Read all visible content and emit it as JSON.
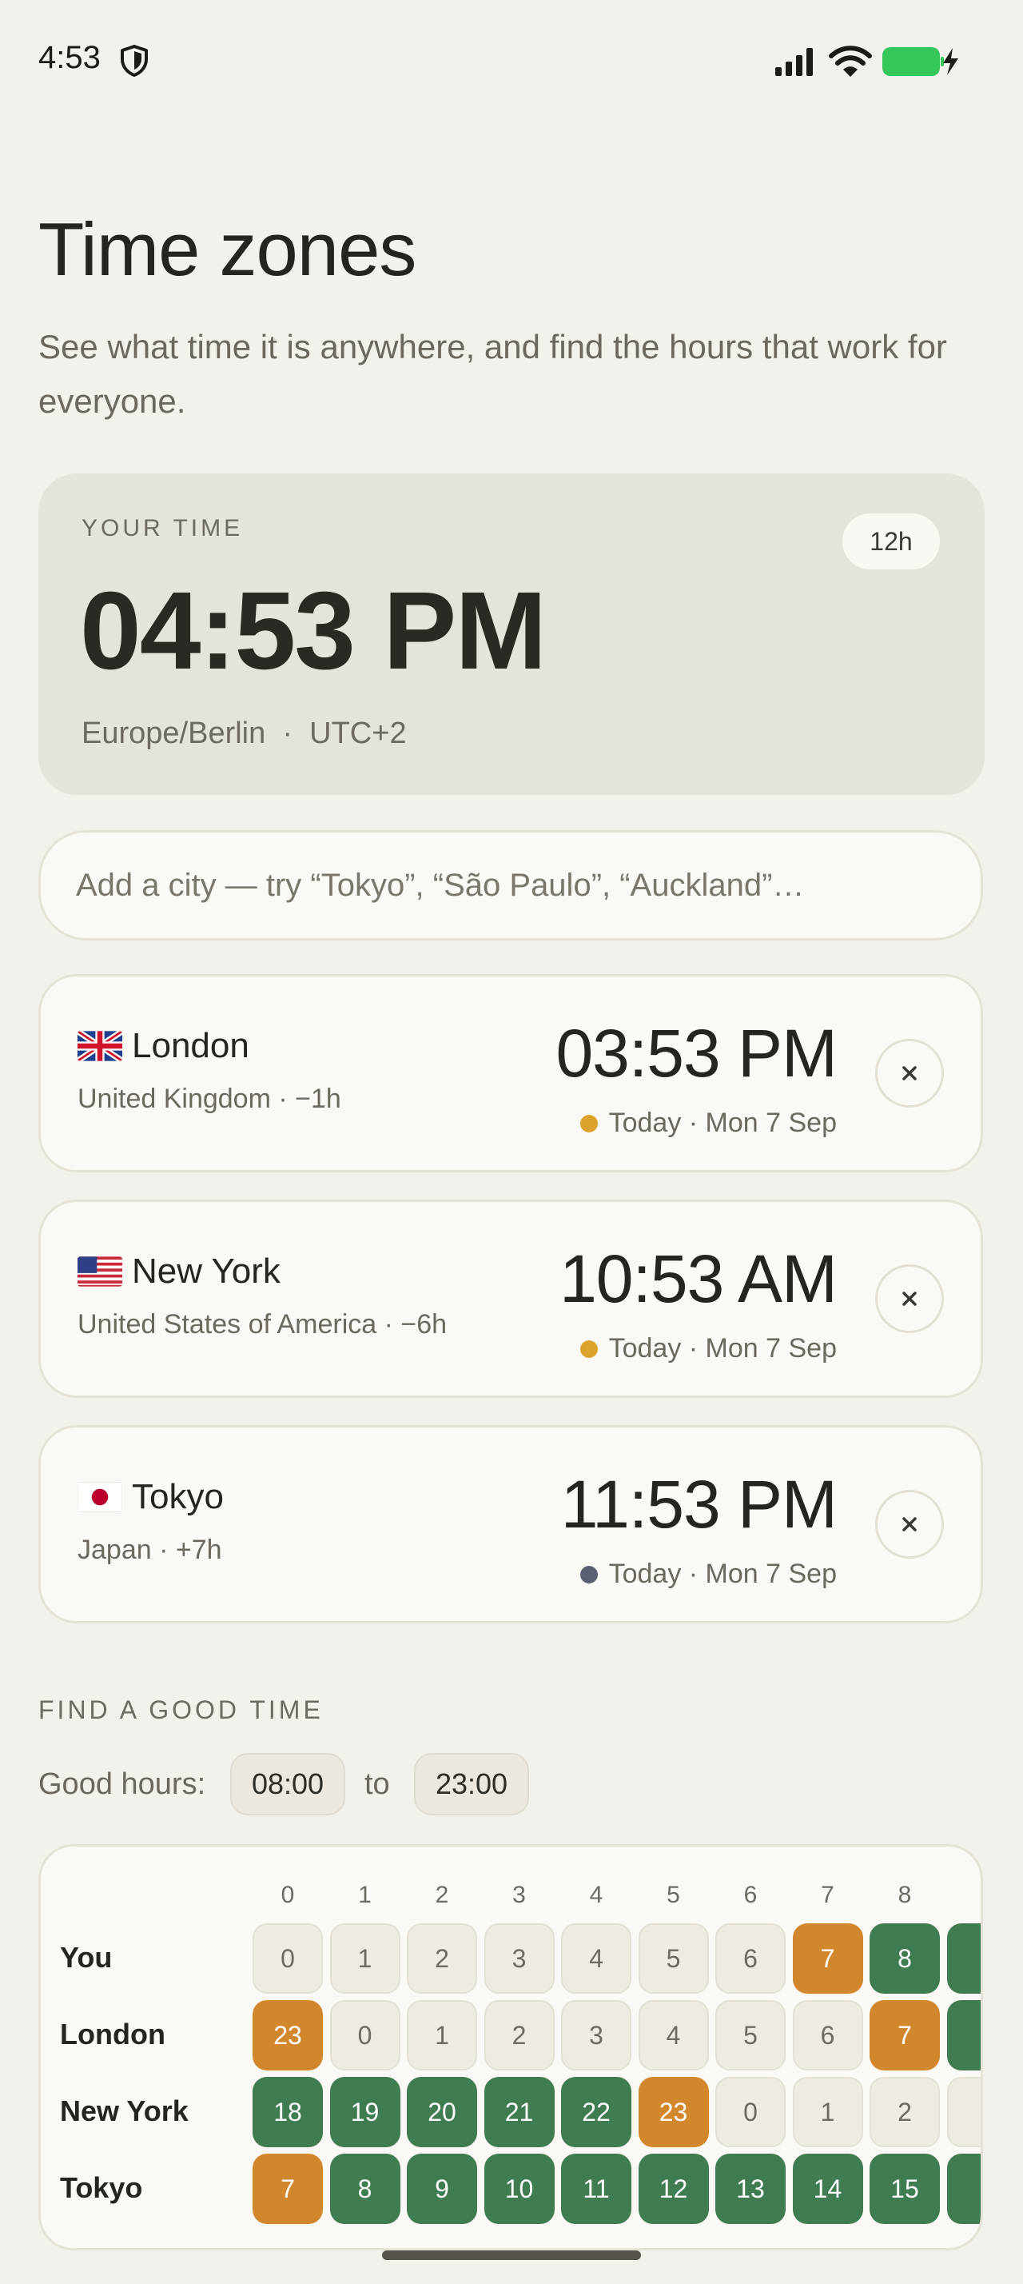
{
  "status_bar": {
    "time": "4:53"
  },
  "header": {
    "title": "Time zones",
    "subtitle": "See what time it is anywhere, and find the hours that work for everyone."
  },
  "your_time": {
    "label": "YOUR TIME",
    "format_toggle": "12h",
    "time": "04:53 PM",
    "zone": "Europe/Berlin",
    "separator": "·",
    "offset": "UTC+2"
  },
  "search": {
    "placeholder": "Add a city — try “Tokyo”, “São Paulo”, “Auckland”…"
  },
  "cities": [
    {
      "flag": "uk-flag",
      "name": "London",
      "meta": "United Kingdom · −1h",
      "time": "03:53 PM",
      "day": "Today · Mon 7 Sep",
      "dot_color": "#dca32c"
    },
    {
      "flag": "us-flag",
      "name": "New York",
      "meta": "United States of America · −6h",
      "time": "10:53 AM",
      "day": "Today · Mon 7 Sep",
      "dot_color": "#dca32c"
    },
    {
      "flag": "jp-flag",
      "name": "Tokyo",
      "meta": "Japan · +7h",
      "time": "11:53 PM",
      "day": "Today · Mon 7 Sep",
      "dot_color": "#5b6070"
    }
  ],
  "find_good_time": {
    "section_label": "FIND A GOOD TIME",
    "good_hours_label": "Good hours:",
    "from": "08:00",
    "to_label": "to",
    "to": "23:00"
  },
  "grid": {
    "hours_header": [
      "0",
      "1",
      "2",
      "3",
      "4",
      "5",
      "6",
      "7",
      "8"
    ],
    "rows": [
      {
        "label": "You",
        "cells": [
          {
            "v": "0",
            "s": "off"
          },
          {
            "v": "1",
            "s": "off"
          },
          {
            "v": "2",
            "s": "off"
          },
          {
            "v": "3",
            "s": "off"
          },
          {
            "v": "4",
            "s": "off"
          },
          {
            "v": "5",
            "s": "off"
          },
          {
            "v": "6",
            "s": "off"
          },
          {
            "v": "7",
            "s": "edge"
          },
          {
            "v": "8",
            "s": "good"
          },
          {
            "v": "",
            "s": "good"
          }
        ]
      },
      {
        "label": "London",
        "cells": [
          {
            "v": "23",
            "s": "edge"
          },
          {
            "v": "0",
            "s": "off"
          },
          {
            "v": "1",
            "s": "off"
          },
          {
            "v": "2",
            "s": "off"
          },
          {
            "v": "3",
            "s": "off"
          },
          {
            "v": "4",
            "s": "off"
          },
          {
            "v": "5",
            "s": "off"
          },
          {
            "v": "6",
            "s": "off"
          },
          {
            "v": "7",
            "s": "edge"
          },
          {
            "v": "",
            "s": "good"
          }
        ]
      },
      {
        "label": "New York",
        "cells": [
          {
            "v": "18",
            "s": "good"
          },
          {
            "v": "19",
            "s": "good"
          },
          {
            "v": "20",
            "s": "good"
          },
          {
            "v": "21",
            "s": "good"
          },
          {
            "v": "22",
            "s": "good"
          },
          {
            "v": "23",
            "s": "edge"
          },
          {
            "v": "0",
            "s": "off"
          },
          {
            "v": "1",
            "s": "off"
          },
          {
            "v": "2",
            "s": "off"
          },
          {
            "v": "",
            "s": "off"
          }
        ]
      },
      {
        "label": "Tokyo",
        "cells": [
          {
            "v": "7",
            "s": "edge"
          },
          {
            "v": "8",
            "s": "good"
          },
          {
            "v": "9",
            "s": "good"
          },
          {
            "v": "10",
            "s": "good"
          },
          {
            "v": "11",
            "s": "good"
          },
          {
            "v": "12",
            "s": "good"
          },
          {
            "v": "13",
            "s": "good"
          },
          {
            "v": "14",
            "s": "good"
          },
          {
            "v": "15",
            "s": "good"
          },
          {
            "v": "",
            "s": "good"
          }
        ]
      }
    ]
  },
  "colors": {
    "good": "#3f7c52",
    "edge": "#d3872d",
    "off": "#eeebe2",
    "battery": "#34c759",
    "your_card": "#e3e5dc",
    "background": "#f3f1ec"
  },
  "icons": [
    "shield-icon",
    "signal-icon",
    "wifi-icon",
    "battery-charging-icon",
    "close-icon"
  ]
}
